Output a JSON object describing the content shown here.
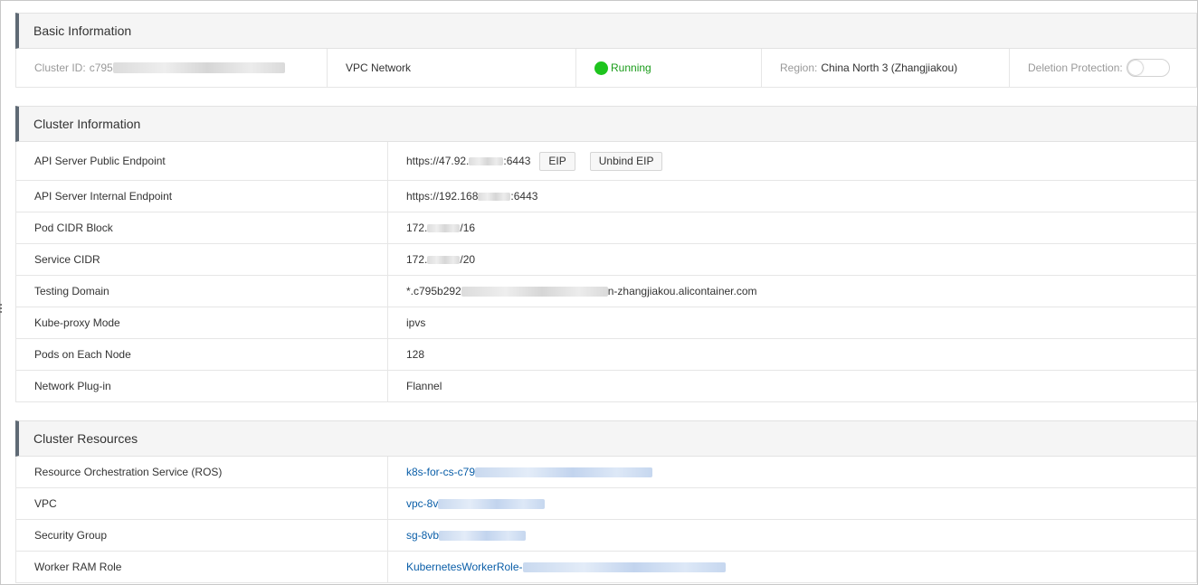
{
  "basic": {
    "title": "Basic Information",
    "cluster_id_label": "Cluster ID:",
    "cluster_id_value": "c795",
    "network_type": "VPC Network",
    "status": "Running",
    "status_color": "#1ec41e",
    "region_label": "Region:",
    "region_value": "China North 3 (Zhangjiakou)",
    "deletion_protection_label": "Deletion Protection:",
    "deletion_protection_enabled": false
  },
  "cluster_info": {
    "title": "Cluster Information",
    "rows": [
      {
        "key": "API Server Public Endpoint",
        "value_prefix": "https://47.92.",
        "value_suffix": ":6443",
        "buttons": [
          "EIP",
          "Unbind EIP"
        ]
      },
      {
        "key": "API Server Internal Endpoint",
        "value_prefix": "https://192.168",
        "value_suffix": ":6443"
      },
      {
        "key": "Pod CIDR Block",
        "value_prefix": "172.",
        "value_suffix": "/16"
      },
      {
        "key": "Service CIDR",
        "value_prefix": "172.",
        "value_suffix": "/20"
      },
      {
        "key": "Testing Domain",
        "value_prefix": "*.c795b292",
        "value_suffix": "n-zhangjiakou.alicontainer.com"
      },
      {
        "key": "Kube-proxy Mode",
        "value": "ipvs"
      },
      {
        "key": "Pods on Each Node",
        "value": "128"
      },
      {
        "key": "Network Plug-in",
        "value": "Flannel"
      }
    ]
  },
  "cluster_resources": {
    "title": "Cluster Resources",
    "rows": [
      {
        "key": "Resource Orchestration Service (ROS)",
        "link_prefix": "k8s-for-cs-c79"
      },
      {
        "key": "VPC",
        "link_prefix": "vpc-8v"
      },
      {
        "key": "Security Group",
        "link_prefix": "sg-8vb"
      },
      {
        "key": "Worker RAM Role",
        "link_prefix": "KubernetesWorkerRole-"
      }
    ]
  }
}
